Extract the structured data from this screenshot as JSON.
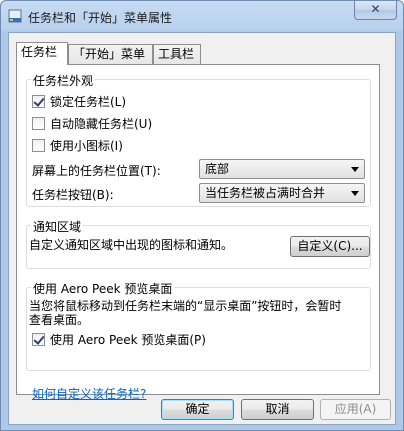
{
  "window": {
    "title": "任务栏和「开始」菜单属性",
    "close_glyph": "✕"
  },
  "tabs": [
    {
      "label": "任务栏"
    },
    {
      "label": "「开始」菜单"
    },
    {
      "label": "工具栏"
    }
  ],
  "appearance": {
    "title": "任务栏外观",
    "lock": {
      "label": "锁定任务栏(L)",
      "checked": true
    },
    "autohide": {
      "label": "自动隐藏任务栏(U)",
      "checked": false
    },
    "small_icons": {
      "label": "使用小图标(I)",
      "checked": false
    },
    "position": {
      "label": "屏幕上的任务栏位置(T):",
      "value": "底部"
    },
    "buttons": {
      "label": "任务栏按钮(B):",
      "value": "当任务栏被占满时合并"
    }
  },
  "notification": {
    "title": "通知区域",
    "description": "自定义通知区域中出现的图标和通知。",
    "customize_button": "自定义(C)..."
  },
  "aero_peek": {
    "title": "使用 Aero Peek 预览桌面",
    "description_line1": "当您将鼠标移动到任务栏末端的“显示桌面”按钮时，会暂时",
    "description_line2": "查看桌面。",
    "use": {
      "label": "使用 Aero Peek 预览桌面(P)",
      "checked": true
    }
  },
  "help_link": "如何自定义该任务栏?",
  "footer": {
    "ok": "确定",
    "cancel": "取消",
    "apply": "应用(A)"
  }
}
